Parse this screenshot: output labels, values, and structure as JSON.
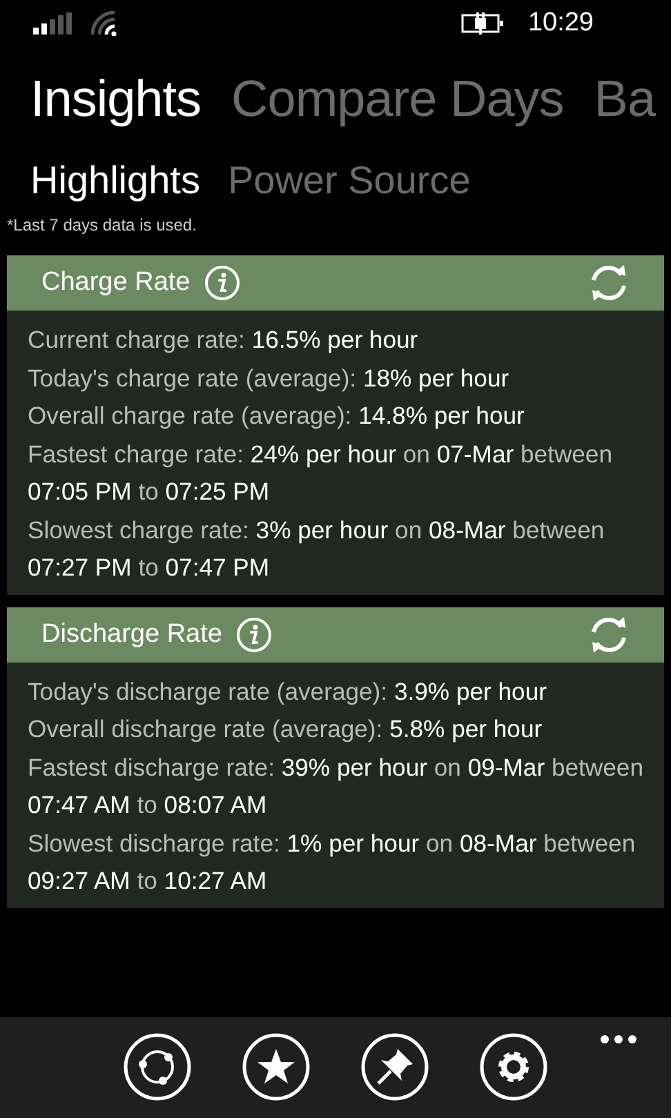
{
  "status_bar": {
    "time": "10:29"
  },
  "pivot": [
    {
      "label": "Insights",
      "selected": true
    },
    {
      "label": "Compare Days",
      "selected": false
    },
    {
      "label": "Ba",
      "selected": false
    }
  ],
  "sub_pivot": [
    {
      "label": "Highlights",
      "selected": true
    },
    {
      "label": "Power Source",
      "selected": false
    }
  ],
  "note": "*Last 7 days data is used.",
  "cards": [
    {
      "title": "Charge Rate",
      "lines": [
        [
          {
            "text": "Current charge rate: ",
            "value": false
          },
          {
            "text": "16.5% per hour",
            "value": true
          }
        ],
        [
          {
            "text": "Today's charge rate (average): ",
            "value": false
          },
          {
            "text": "18% per hour",
            "value": true
          }
        ],
        [
          {
            "text": "Overall charge rate (average): ",
            "value": false
          },
          {
            "text": "14.8% per hour",
            "value": true
          }
        ],
        [
          {
            "text": "Fastest charge rate: ",
            "value": false
          },
          {
            "text": "24% per hour",
            "value": true
          },
          {
            "text": " on ",
            "value": false
          },
          {
            "text": "07-Mar",
            "value": true
          },
          {
            "text": " between ",
            "value": false
          },
          {
            "text": "07:05 PM",
            "value": true
          },
          {
            "text": " to ",
            "value": false
          },
          {
            "text": "07:25 PM",
            "value": true
          }
        ],
        [
          {
            "text": "Slowest charge rate: ",
            "value": false
          },
          {
            "text": "3% per hour",
            "value": true
          },
          {
            "text": " on ",
            "value": false
          },
          {
            "text": "08-Mar",
            "value": true
          },
          {
            "text": " between ",
            "value": false
          },
          {
            "text": "07:27 PM",
            "value": true
          },
          {
            "text": " to ",
            "value": false
          },
          {
            "text": "07:47 PM",
            "value": true
          }
        ]
      ]
    },
    {
      "title": "Discharge Rate",
      "lines": [
        [
          {
            "text": "Today's discharge rate (average): ",
            "value": false
          },
          {
            "text": "3.9% per hour",
            "value": true
          }
        ],
        [
          {
            "text": "Overall discharge rate (average): ",
            "value": false
          },
          {
            "text": "5.8% per hour",
            "value": true
          }
        ],
        [
          {
            "text": "Fastest discharge rate: ",
            "value": false
          },
          {
            "text": "39% per hour",
            "value": true
          },
          {
            "text": " on ",
            "value": false
          },
          {
            "text": "09-Mar",
            "value": true
          },
          {
            "text": " between ",
            "value": false
          },
          {
            "text": "07:47 AM",
            "value": true
          },
          {
            "text": " to ",
            "value": false
          },
          {
            "text": "08:07 AM",
            "value": true
          }
        ],
        [
          {
            "text": "Slowest discharge rate: ",
            "value": false
          },
          {
            "text": "1% per hour",
            "value": true
          },
          {
            "text": " on ",
            "value": false
          },
          {
            "text": "08-Mar",
            "value": true
          },
          {
            "text": " between ",
            "value": false
          },
          {
            "text": "09:27 AM",
            "value": true
          },
          {
            "text": " to ",
            "value": false
          },
          {
            "text": "10:27 AM",
            "value": true
          }
        ]
      ]
    }
  ],
  "app_bar": [
    {
      "kind": "sync"
    },
    {
      "kind": "star"
    },
    {
      "kind": "pin"
    },
    {
      "kind": "settings"
    }
  ]
}
